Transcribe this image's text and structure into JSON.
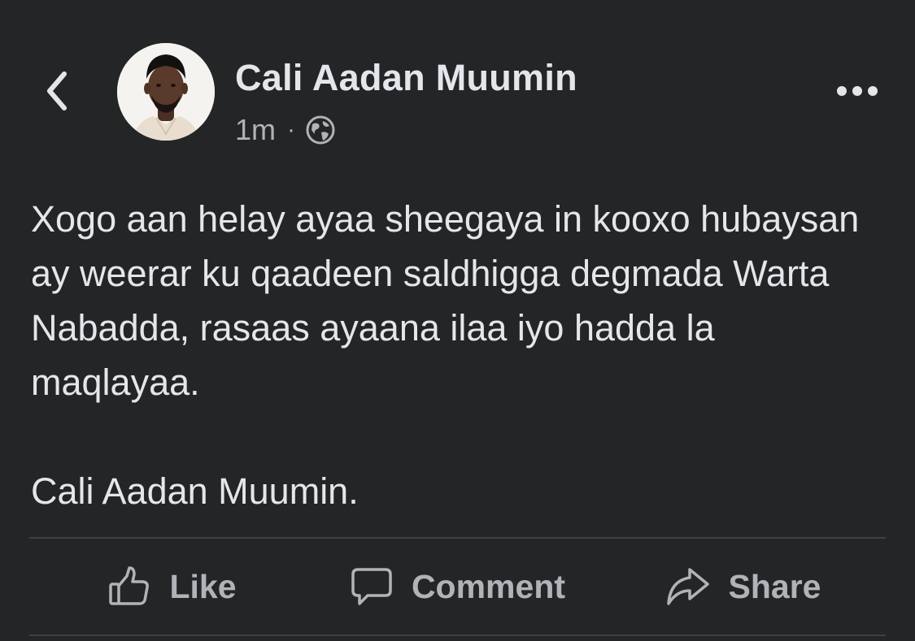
{
  "header": {
    "back_icon": "chevron-left-icon",
    "author_name": "Cali Aadan Muumin",
    "time_ago": "1m",
    "separator": "·",
    "privacy_icon": "globe-icon",
    "more_icon": "more-horizontal-icon"
  },
  "post": {
    "text": "Xogo aan helay ayaa sheegaya in kooxo hubaysan ay weerar ku qaadeen saldhigga degmada Warta Nabadda, rasaas ayaana ilaa iyo hadda la maqlayaa.",
    "signature": "Cali Aadan Muumin."
  },
  "actions": {
    "like": {
      "label": "Like",
      "icon": "thumbs-up-icon"
    },
    "comment": {
      "label": "Comment",
      "icon": "comment-bubble-icon"
    },
    "share": {
      "label": "Share",
      "icon": "share-arrow-icon"
    }
  },
  "colors": {
    "background": "#242526",
    "primary_text": "#e4e6eb",
    "secondary_text": "#b0b3b8",
    "divider": "#3e4042"
  }
}
